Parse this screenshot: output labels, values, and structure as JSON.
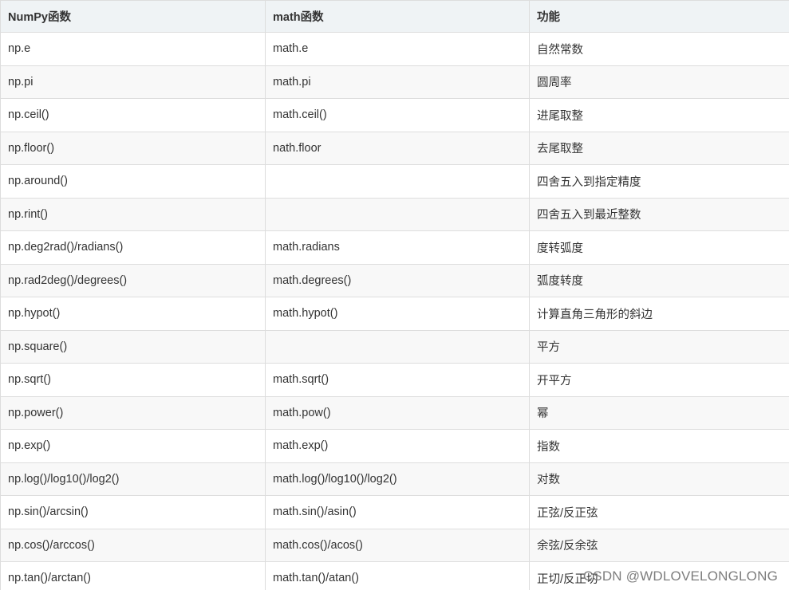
{
  "table": {
    "headers": [
      "NumPy函数",
      "math函数",
      "功能"
    ],
    "rows": [
      [
        "np.e",
        "math.e",
        "自然常数"
      ],
      [
        "np.pi",
        "math.pi",
        "圆周率"
      ],
      [
        "np.ceil()",
        "math.ceil()",
        "进尾取整"
      ],
      [
        "np.floor()",
        "nath.floor",
        "去尾取整"
      ],
      [
        "np.around()",
        "",
        "四舍五入到指定精度"
      ],
      [
        "np.rint()",
        "",
        "四舍五入到最近整数"
      ],
      [
        "np.deg2rad()/radians()",
        "math.radians",
        "度转弧度"
      ],
      [
        "np.rad2deg()/degrees()",
        "math.degrees()",
        "弧度转度"
      ],
      [
        "np.hypot()",
        "math.hypot()",
        "计算直角三角形的斜边"
      ],
      [
        "np.square()",
        "",
        "平方"
      ],
      [
        "np.sqrt()",
        "math.sqrt()",
        "开平方"
      ],
      [
        "np.power()",
        "math.pow()",
        "幂"
      ],
      [
        "np.exp()",
        "math.exp()",
        "指数"
      ],
      [
        "np.log()/log10()/log2()",
        "math.log()/log10()/log2()",
        "对数"
      ],
      [
        "np.sin()/arcsin()",
        "math.sin()/asin()",
        "正弦/反正弦"
      ],
      [
        "np.cos()/arccos()",
        "math.cos()/acos()",
        "余弦/反余弦"
      ],
      [
        "np.tan()/arctan()",
        "math.tan()/atan()",
        "正切/反正切"
      ]
    ]
  },
  "watermark": "CSDN @WDLOVELONGLONG"
}
